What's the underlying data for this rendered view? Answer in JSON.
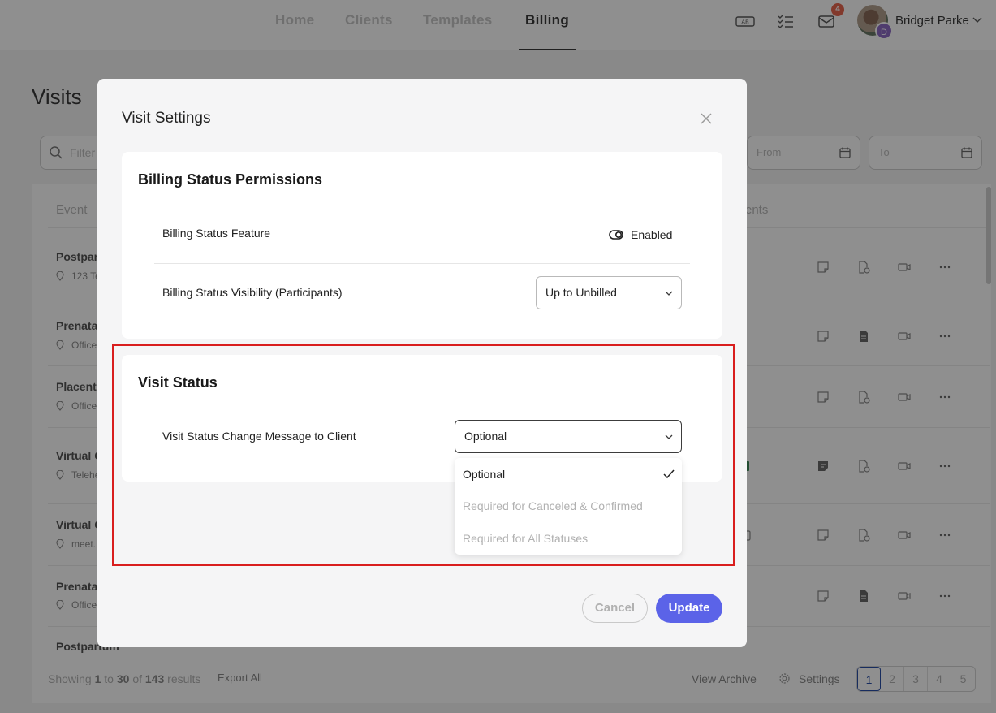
{
  "topnav": {
    "tabs": [
      {
        "label": "Home"
      },
      {
        "label": "Clients"
      },
      {
        "label": "Templates"
      },
      {
        "label": "Billing",
        "active": true
      }
    ],
    "icons": [
      "ab-test-icon",
      "checklist-icon",
      "mail-icon"
    ],
    "mail_badge": "4",
    "avatar_initial": "D",
    "user_name": "Bridget Parke"
  },
  "page": {
    "title": "Visits",
    "filter_placeholder": "Filter",
    "from_placeholder": "From",
    "to_placeholder": "To",
    "columns": {
      "event": "Event",
      "attachments": "ents"
    },
    "rows": [
      {
        "title": "Postpart",
        "sub": "123 Te"
      },
      {
        "title": "Prenatal",
        "sub": "Office"
      },
      {
        "title": "Placenta",
        "sub": "Office"
      },
      {
        "title": "Virtual C",
        "sub": "Telehe"
      },
      {
        "title": "Virtual C",
        "sub": "meet."
      },
      {
        "title": "Prenatal",
        "sub": "Office"
      },
      {
        "title": "Postpartum",
        "sub": ""
      }
    ],
    "footer": {
      "showing": "Showing",
      "from": "1",
      "to_word": "to",
      "to": "30",
      "of_word": "of",
      "total": "143",
      "results": "results",
      "export": "Export All",
      "view_archive": "View Archive",
      "settings": "Settings",
      "pages": [
        "1",
        "2",
        "3",
        "4",
        "5"
      ],
      "current_page": "1"
    }
  },
  "modal": {
    "title": "Visit Settings",
    "billing_section": {
      "title": "Billing Status Permissions",
      "feature_label": "Billing Status Feature",
      "feature_state": "Enabled",
      "visibility_label": "Billing Status Visibility (Participants)",
      "visibility_value": "Up to Unbilled"
    },
    "visit_section": {
      "title": "Visit Status",
      "message_label": "Visit Status Change Message to Client",
      "message_value": "Optional",
      "options": [
        {
          "label": "Optional",
          "selected": true
        },
        {
          "label": "Required for Canceled & Confirmed",
          "selected": false
        },
        {
          "label": "Required for All Statuses",
          "selected": false
        }
      ]
    },
    "cancel_label": "Cancel",
    "update_label": "Update"
  },
  "colors": {
    "accent": "#5b63e8",
    "highlight": "#d91e1e",
    "badge": "#e8664f"
  }
}
